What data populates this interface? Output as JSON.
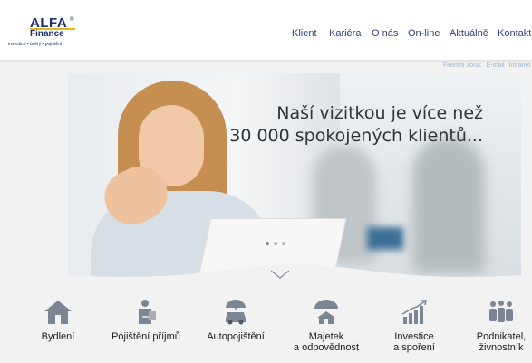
{
  "logo": {
    "name": "ALFA",
    "reg": "®",
    "sub": "Finance",
    "tagline": "investice • úvěry • pojištění"
  },
  "nav": {
    "items": [
      "Klient",
      "Kariéra",
      "O nás",
      "On-line",
      "Aktuálně",
      "Kontakt"
    ]
  },
  "zone": {
    "label": "Firemní zóna:",
    "email": "E-mail",
    "intranet": "Intranet"
  },
  "hero": {
    "line1": "Naší vizitkou je více než",
    "line2": "30 000 spokojených klientů..."
  },
  "slider": {
    "dots": 3,
    "active": 1
  },
  "categories": [
    {
      "label": "Bydlení",
      "label2": "",
      "icon": "house-icon"
    },
    {
      "label": "Pojištění příjmů",
      "label2": "",
      "icon": "injured-person-icon"
    },
    {
      "label": "Autopojištění",
      "label2": "",
      "icon": "car-umbrella-icon"
    },
    {
      "label": "Majetek",
      "label2": "a odpovědnost",
      "icon": "house-umbrella-icon"
    },
    {
      "label": "Investice",
      "label2": "a spoření",
      "icon": "growth-chart-icon"
    },
    {
      "label": "Podnikatel,",
      "label2": "živnostník",
      "icon": "people-group-icon"
    }
  ],
  "colors": {
    "brand": "#1a2f6e",
    "accent": "#e6b817",
    "icon": "#7b8594"
  }
}
